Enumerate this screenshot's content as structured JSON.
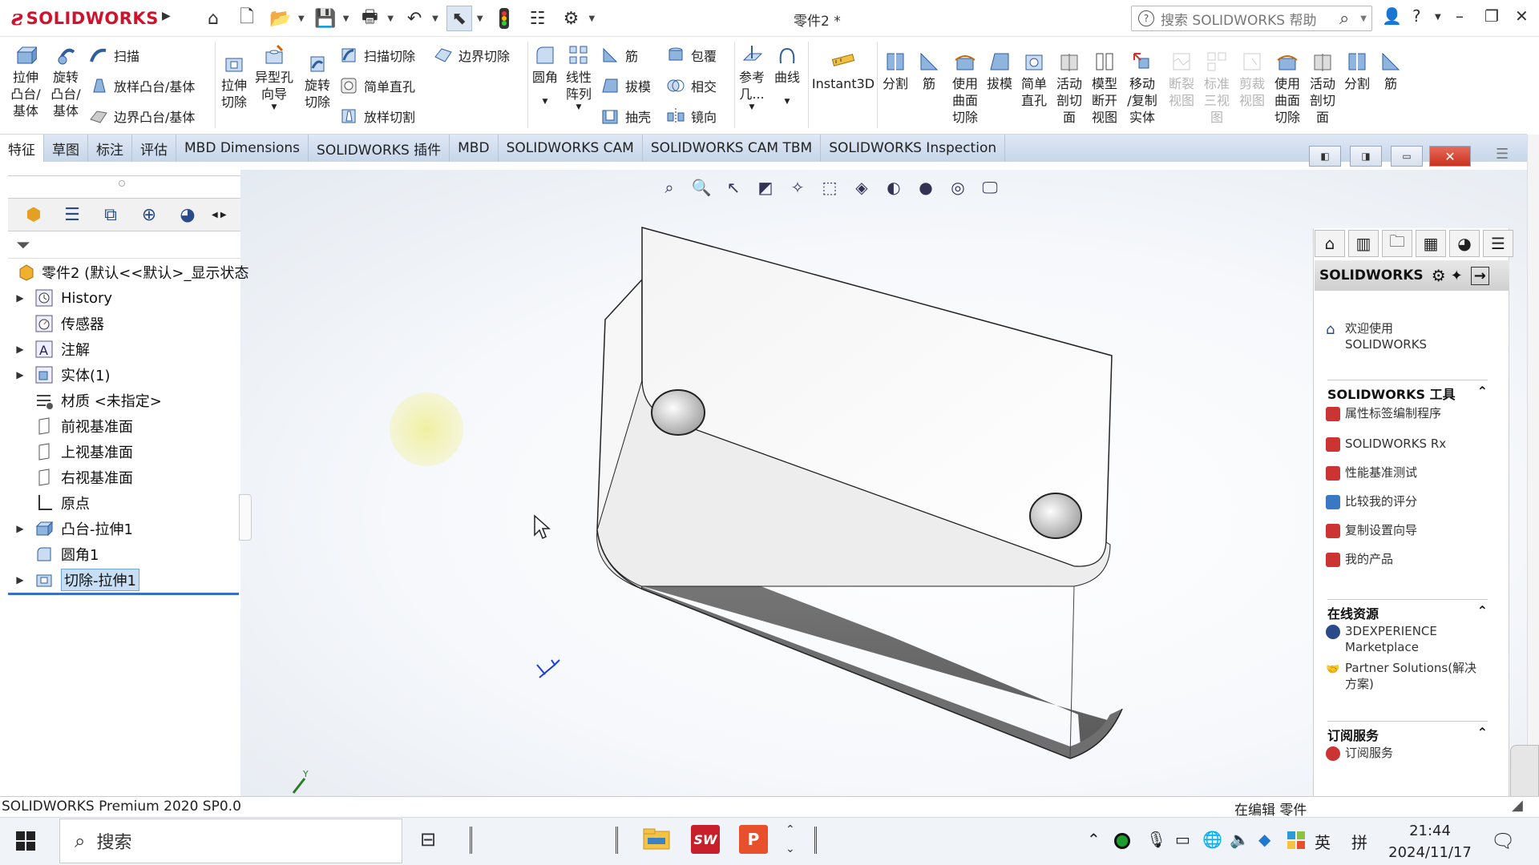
{
  "app": {
    "brand": "SOLIDWORKS",
    "document_title": "零件2 *"
  },
  "search": {
    "placeholder": "搜索 SOLIDWORKS 帮助"
  },
  "ribbon": {
    "extrude_boss": "拉伸\n凸台/\n基体",
    "revolve_boss": "旋转\n凸台/\n基体",
    "sweep": "扫描",
    "loft_boss": "放样凸台/基体",
    "boundary_boss": "边界凸台/基体",
    "extrude_cut": "拉伸\n切除",
    "hole_wizard": "异型孔\n向导",
    "revolve_cut": "旋转\n切除",
    "sweep_cut": "扫描切除",
    "simple_hole": "简单直孔",
    "loft_cut": "放样切割",
    "boundary_cut": "边界切除",
    "fillet": "圆角",
    "linear_pattern": "线性\n阵列",
    "rib": "筋",
    "draft": "拔模",
    "shell": "抽壳",
    "wrap": "包覆",
    "intersect": "相交",
    "mirror": "镜向",
    "ref_geometry": "参考\n几...",
    "curves": "曲线",
    "instant3d": "Instant3D",
    "split": "分割",
    "rib2": "筋",
    "surface_cut": "使用\n曲面\n切除",
    "draft2": "拔模",
    "simple_hole2": "简单\n直孔",
    "live_section": "活动\n剖切\n面",
    "model_break": "模型\n断开\n视图",
    "move_copy": "移动\n/复制\n实体",
    "broken_view": "断裂\n视图",
    "std_3view": "标准\n三视\n图",
    "crop_view": "剪裁\n视图",
    "surface_cut2": "使用\n曲面\n切除",
    "live_section2": "活动\n剖切\n面",
    "split2": "分割",
    "rib3": "筋"
  },
  "tabs": [
    "特征",
    "草图",
    "标注",
    "评估",
    "MBD Dimensions",
    "SOLIDWORKS 插件",
    "MBD",
    "SOLIDWORKS CAM",
    "SOLIDWORKS CAM TBM",
    "SOLIDWORKS Inspection"
  ],
  "tree": {
    "root": "零件2 (默认<<默认>_显示状态",
    "items": [
      {
        "label": "History",
        "expandable": true
      },
      {
        "label": "传感器",
        "expandable": false
      },
      {
        "label": "注解",
        "expandable": true
      },
      {
        "label": "实体(1)",
        "expandable": true
      },
      {
        "label": "材质 <未指定>",
        "expandable": false
      },
      {
        "label": "前视基准面",
        "expandable": false
      },
      {
        "label": "上视基准面",
        "expandable": false
      },
      {
        "label": "右视基准面",
        "expandable": false
      },
      {
        "label": "原点",
        "expandable": false
      },
      {
        "label": "凸台-拉伸1",
        "expandable": true
      },
      {
        "label": "圆角1",
        "expandable": false
      },
      {
        "label": "切除-拉伸1",
        "expandable": true,
        "selected": true
      }
    ]
  },
  "taskpane": {
    "title": "SOLIDWORKS",
    "welcome": "欢迎使用\nSOLIDWORKS",
    "tools_header": "SOLIDWORKS 工具",
    "tools": [
      "属性标签编制程序",
      "SOLIDWORKS Rx",
      "性能基准测试",
      "比较我的评分",
      "复制设置向导",
      "我的产品"
    ],
    "online_header": "在线资源",
    "online": [
      "3DEXPERIENCE\nMarketplace",
      "Partner Solutions(解决\n方案)"
    ],
    "subscription_header": "订阅服务",
    "subscription": [
      "订阅服务"
    ]
  },
  "status": {
    "left": "SOLIDWORKS Premium 2020 SP0.0",
    "right": "在编辑 零件"
  },
  "taskbar": {
    "search": "搜索",
    "ime_lang": "英",
    "ime_mode": "拼",
    "time": "21:44",
    "date": "2024/11/17"
  },
  "triad_label": "Y",
  "colors": {
    "brand_red": "#d0122c",
    "selection_blue": "#3a6fc6",
    "tab_bar": "#c7d6ea"
  }
}
